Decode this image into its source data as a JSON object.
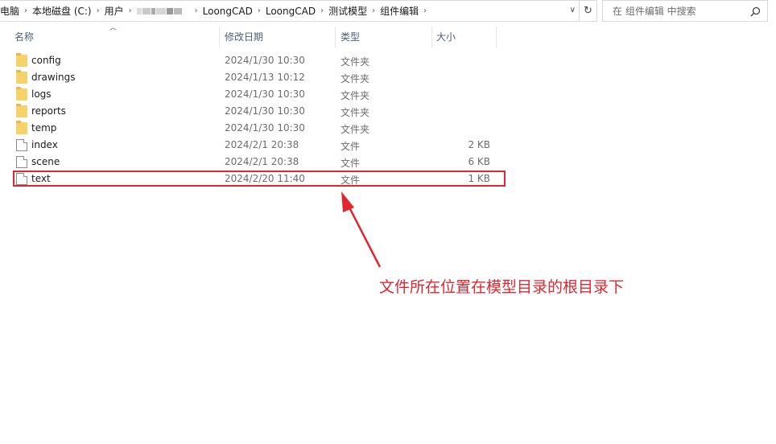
{
  "address_bar": {
    "crumbs": [
      "电脑",
      "本地磁盘 (C:)",
      "用户",
      "LoongCAD",
      "LoongCAD",
      "测试模型",
      "组件编辑"
    ]
  },
  "search": {
    "placeholder": "在 组件编辑 中搜索"
  },
  "columns": {
    "name": "名称",
    "date": "修改日期",
    "type": "类型",
    "size": "大小"
  },
  "files": [
    {
      "name": "config",
      "date": "2024/1/30 10:30",
      "type": "文件夹",
      "size": "",
      "icon": "folder-icon"
    },
    {
      "name": "drawings",
      "date": "2024/1/13 10:12",
      "type": "文件夹",
      "size": "",
      "icon": "folder-icon"
    },
    {
      "name": "logs",
      "date": "2024/1/30 10:30",
      "type": "文件夹",
      "size": "",
      "icon": "folder-icon"
    },
    {
      "name": "reports",
      "date": "2024/1/30 10:30",
      "type": "文件夹",
      "size": "",
      "icon": "folder-icon"
    },
    {
      "name": "temp",
      "date": "2024/1/30 10:30",
      "type": "文件夹",
      "size": "",
      "icon": "folder-icon"
    },
    {
      "name": "index",
      "date": "2024/2/1 20:38",
      "type": "文件",
      "size": "2 KB",
      "icon": "file-icon"
    },
    {
      "name": "scene",
      "date": "2024/2/1 20:38",
      "type": "文件",
      "size": "6 KB",
      "icon": "file-icon"
    },
    {
      "name": "text",
      "date": "2024/2/20 11:40",
      "type": "文件",
      "size": "1 KB",
      "icon": "file-icon"
    }
  ],
  "annotation": {
    "text": "文件所在位置在模型目录的根目录下",
    "color": "#e0262f"
  }
}
